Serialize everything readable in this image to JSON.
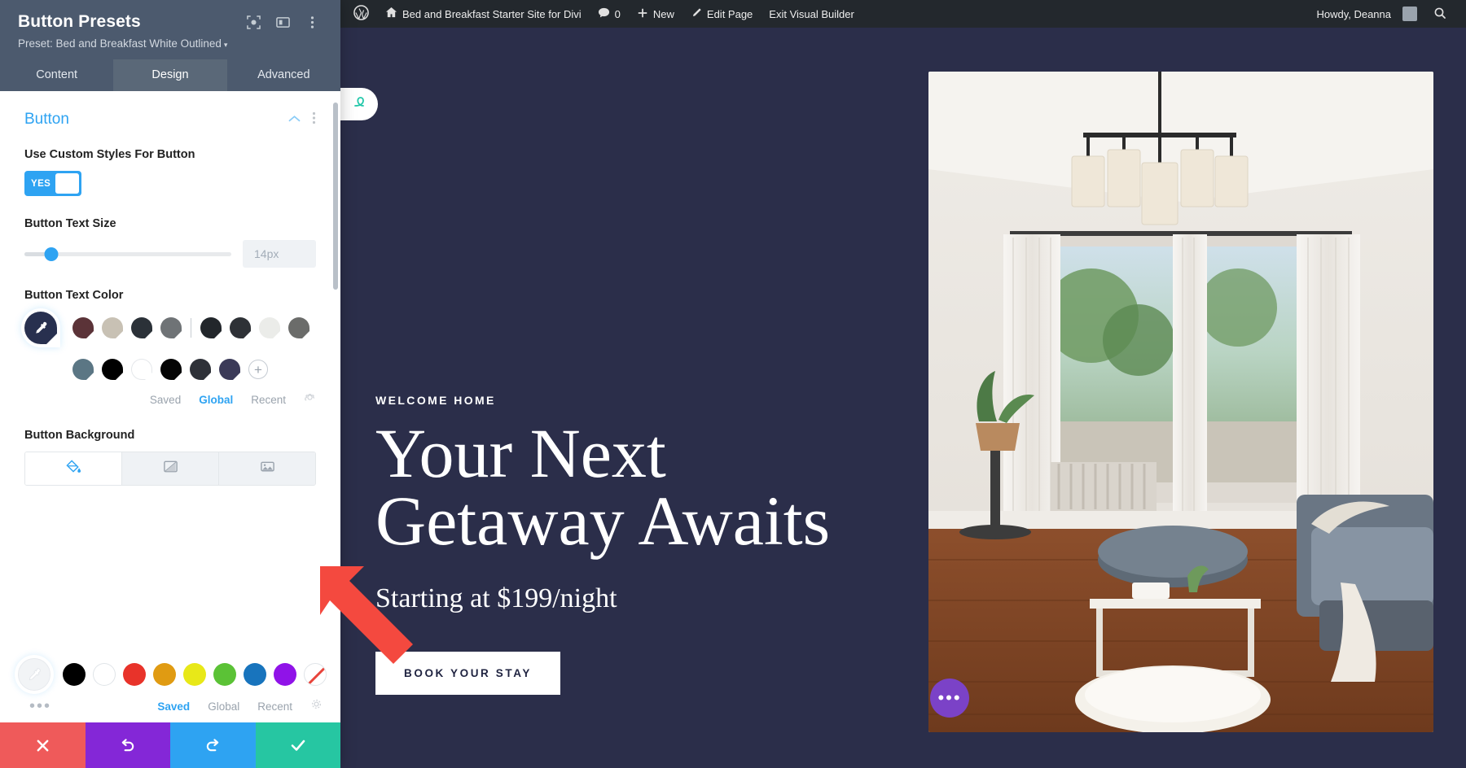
{
  "panel": {
    "title": "Button Presets",
    "preset_label": "Preset: Bed and Breakfast White Outlined",
    "preset_caret": "▾",
    "icons": {
      "focus": "focus-target-icon",
      "layout": "panel-layout-icon",
      "more": "kebab-menu-icon"
    },
    "tabs": [
      {
        "label": "Content",
        "active": false
      },
      {
        "label": "Design",
        "active": true
      },
      {
        "label": "Advanced",
        "active": false
      }
    ],
    "section": {
      "title": "Button",
      "collapse_icon": "chevron-up-icon",
      "more_icon": "kebab-menu-icon"
    },
    "fields": {
      "use_custom_styles": {
        "label": "Use Custom Styles For Button",
        "toggle_value": "YES"
      },
      "text_size": {
        "label": "Button Text Size",
        "value": "14px",
        "slider_percent": 13
      },
      "text_color": {
        "label": "Button Text Color",
        "eyedropper_icon": "eyedropper-icon",
        "row1": [
          "#5b3338",
          "#c8c1b4",
          "#2b3138",
          "#6f7376",
          "#22262b",
          "#2e3136",
          "#ebece9",
          "#6b6c6a"
        ],
        "row2": [
          "#5b7684",
          "#000000",
          "#ffffff",
          "#050505",
          "#2e3138",
          "#3b3a58"
        ],
        "add_label": "+",
        "scope_tabs": [
          {
            "label": "Saved",
            "active": false
          },
          {
            "label": "Global",
            "active": true
          },
          {
            "label": "Recent",
            "active": false
          }
        ],
        "settings_icon": "gear-icon"
      },
      "background": {
        "label": "Button Background",
        "tabs": [
          {
            "icon": "paint-bucket-icon",
            "active": true
          },
          {
            "icon": "gradient-icon",
            "active": false
          },
          {
            "icon": "image-icon",
            "active": false
          }
        ]
      }
    },
    "color_picker": {
      "eyedropper_icon": "eyedropper-icon",
      "swatches": [
        "#000000",
        "#ffffff",
        "#e8332a",
        "#e09b12",
        "#e8e818",
        "#5bc236",
        "#1874bd",
        "#9013e8"
      ],
      "none_icon": "no-color-icon",
      "overflow_icon": "more-dots-icon",
      "scope_tabs": [
        {
          "label": "Saved",
          "active": true
        },
        {
          "label": "Global",
          "active": false
        },
        {
          "label": "Recent",
          "active": false
        }
      ],
      "settings_icon": "gear-icon"
    },
    "actions": [
      {
        "name": "discard",
        "icon": "close-x-icon",
        "color": "#ef5a5a"
      },
      {
        "name": "undo",
        "icon": "undo-arrow-icon",
        "color": "#8427d7"
      },
      {
        "name": "redo",
        "icon": "redo-arrow-icon",
        "color": "#2ea3f2"
      },
      {
        "name": "save",
        "icon": "checkmark-icon",
        "color": "#26c6a2"
      }
    ]
  },
  "adminbar": {
    "wp_logo": "wordpress-logo-icon",
    "site_icon": "home-icon",
    "site_title": "Bed and Breakfast Starter Site for Divi",
    "comments_icon": "comment-bubble-icon",
    "comments_count": "0",
    "new_icon": "plus-icon",
    "new_label": "New",
    "edit_icon": "pencil-icon",
    "edit_label": "Edit Page",
    "exit_label": "Exit Visual Builder",
    "howdy": "Howdy, Deanna",
    "avatar": "user-avatar",
    "search_icon": "search-icon"
  },
  "canvas": {
    "divi_tab_icon": "divi-logo-icon",
    "eyebrow": "WELCOME HOME",
    "headline_line1": "Your Next",
    "headline_line2": "Getaway Awaits",
    "subline": "Starting at $199/night",
    "cta_label": "BOOK YOUR STAY",
    "fab_icon": "more-dots-icon",
    "hero_image_alt": "living-room-photo"
  },
  "annotation": {
    "arrow": "red-arrow-pointing-to-save-button"
  },
  "colors": {
    "accent_blue": "#2ea3f2",
    "panel_header": "#4c5a6e",
    "adminbar": "#23282d",
    "canvas_bg": "#2b2e4a",
    "save_green": "#26c6a2",
    "arrow_red": "#f4493f"
  }
}
